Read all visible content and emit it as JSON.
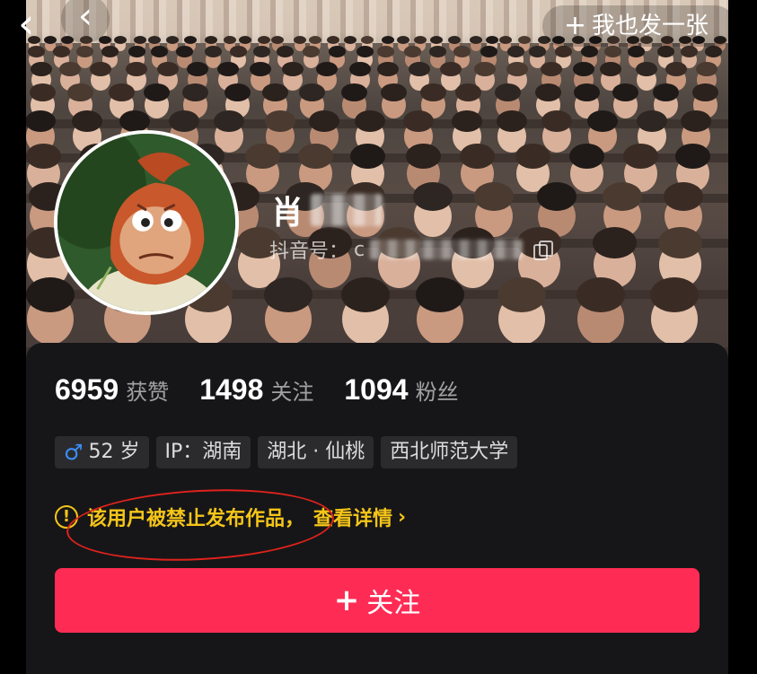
{
  "header": {
    "back_icon": "chevron-left",
    "post_button_label": "我也发一张",
    "post_button_icon": "plus"
  },
  "profile": {
    "name_visible": "肖",
    "id_label": "抖音号：",
    "id_value_visible": "c",
    "copy_icon": "copy"
  },
  "stats": [
    {
      "num": "6959",
      "label": "获赞"
    },
    {
      "num": "1498",
      "label": "关注"
    },
    {
      "num": "1094",
      "label": "粉丝"
    }
  ],
  "tags": [
    {
      "text": "52 岁",
      "icon": "male-symbol"
    },
    {
      "text": "IP：湖南"
    },
    {
      "text": "湖北 · 仙桃"
    },
    {
      "text": "西北师范大学"
    }
  ],
  "notice": {
    "icon": "exclamation-circle",
    "text": "该用户被禁止发布作品，",
    "link": "查看详情"
  },
  "follow_button": {
    "label": "关注",
    "icon": "plus"
  },
  "colors": {
    "accent": "#fe2c55",
    "warning": "#f5c518",
    "annotation": "#e0221c",
    "card_bg": "#161618",
    "male_blue": "#3b8ff7"
  }
}
